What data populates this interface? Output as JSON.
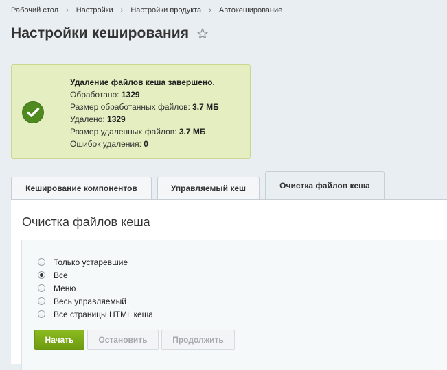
{
  "breadcrumb": {
    "items": [
      "Рабочий стол",
      "Настройки",
      "Настройки продукта",
      "Автокеширование"
    ]
  },
  "page": {
    "title": "Настройки кеширования"
  },
  "notice": {
    "title": "Удаление файлов кеша завершено.",
    "lines": [
      {
        "label": "Обработано: ",
        "value": "1329"
      },
      {
        "label": "Размер обработанных файлов: ",
        "value": "3.7 МБ"
      },
      {
        "label": "Удалено: ",
        "value": "1329"
      },
      {
        "label": "Размер удаленных файлов: ",
        "value": "3.7 МБ"
      },
      {
        "label": "Ошибок удаления: ",
        "value": "0"
      }
    ],
    "colors": {
      "background": "#e4eec1",
      "icon": "#4f8a1e"
    }
  },
  "tabs": [
    {
      "label": "Кеширование компонентов",
      "active": false
    },
    {
      "label": "Управляемый кеш",
      "active": false
    },
    {
      "label": "Очистка файлов кеша",
      "active": true
    }
  ],
  "panel": {
    "title": "Очистка файлов кеша",
    "options": [
      {
        "label": "Только устаревшие",
        "checked": false
      },
      {
        "label": "Все",
        "checked": true
      },
      {
        "label": "Меню",
        "checked": false
      },
      {
        "label": "Весь управляемый",
        "checked": false
      },
      {
        "label": "Все страницы HTML кеша",
        "checked": false
      }
    ],
    "buttons": {
      "start": "Начать",
      "stop": "Остановить",
      "continue": "Продолжить"
    }
  }
}
